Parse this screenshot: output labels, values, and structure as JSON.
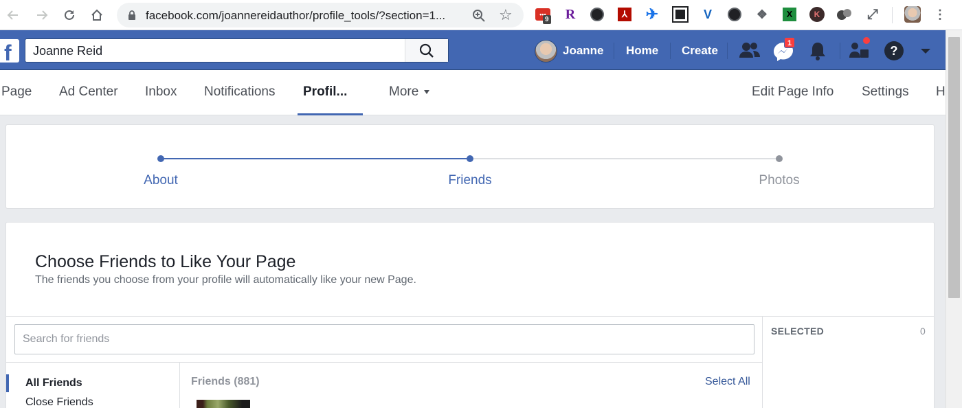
{
  "browser": {
    "url": "facebook.com/joannereidauthor/profile_tools/?section=1...",
    "extension_badge": "9",
    "extensions": [
      "mail-extension-icon",
      "r-extension-icon",
      "github-icon",
      "pdf-icon",
      "plane-icon",
      "qr-icon",
      "v-extension-icon",
      "github-icon-2",
      "dropbox-icon",
      "excel-icon",
      "k-extension-icon",
      "spheres-icon",
      "expand-icon"
    ]
  },
  "facebook": {
    "search_value": "Joanne Reid",
    "user_name": "Joanne",
    "home_label": "Home",
    "create_label": "Create",
    "messenger_badge": "1",
    "brand_color": "#4267b2"
  },
  "page_nav": {
    "tabs": [
      {
        "label": "Page"
      },
      {
        "label": "Ad Center"
      },
      {
        "label": "Inbox"
      },
      {
        "label": "Notifications"
      },
      {
        "label": "Profil..."
      },
      {
        "label": "More"
      }
    ],
    "right": [
      {
        "label": "Edit Page Info"
      },
      {
        "label": "Settings"
      },
      {
        "label": "H"
      }
    ]
  },
  "progress": {
    "steps": [
      {
        "label": "About",
        "state": "done"
      },
      {
        "label": "Friends",
        "state": "current"
      },
      {
        "label": "Photos",
        "state": "pending"
      }
    ],
    "active_color": "#4267b2",
    "pending_color": "#90949c"
  },
  "choose_friends": {
    "title": "Choose Friends to Like Your Page",
    "subtitle": "The friends you choose from your profile will automatically like your new Page.",
    "search_placeholder": "Search for friends",
    "selected_label": "SELECTED",
    "selected_count": "0",
    "lists": [
      {
        "label": "All Friends",
        "active": true
      },
      {
        "label": "Close Friends",
        "active": false
      }
    ],
    "friends_heading": "Friends (881)",
    "select_all": "Select All"
  }
}
